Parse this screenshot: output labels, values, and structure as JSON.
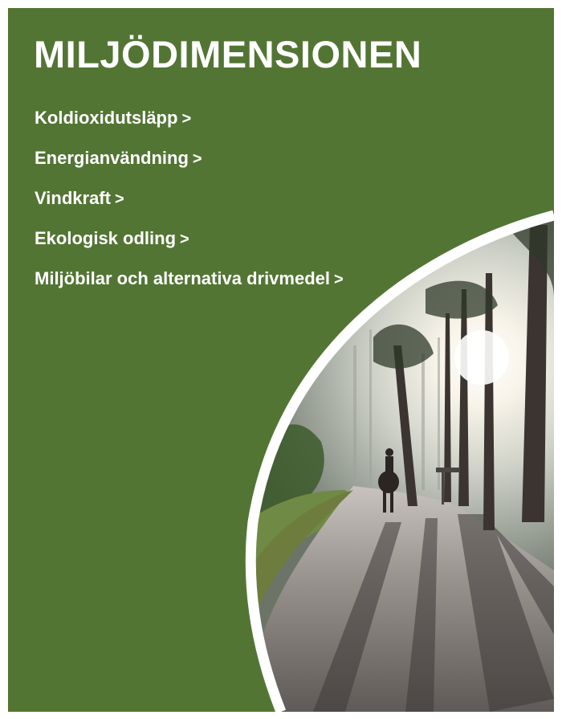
{
  "heading": {
    "title": "MILJÖDIMENSIONEN"
  },
  "menu": {
    "items": [
      {
        "label": "Koldioxidutsläpp",
        "chevron": ">"
      },
      {
        "label": "Energianvändning",
        "chevron": ">"
      },
      {
        "label": "Vindkraft",
        "chevron": ">"
      },
      {
        "label": "Ekologisk odling",
        "chevron": ">"
      },
      {
        "label": "Miljöbilar och alternativa drivmedel",
        "chevron": ">"
      }
    ]
  },
  "photo": {
    "subject": "forest-road-horse-rider-photo"
  },
  "colors": {
    "panel_green": "#537534",
    "text": "#ffffff",
    "frame": "#ffffff"
  }
}
